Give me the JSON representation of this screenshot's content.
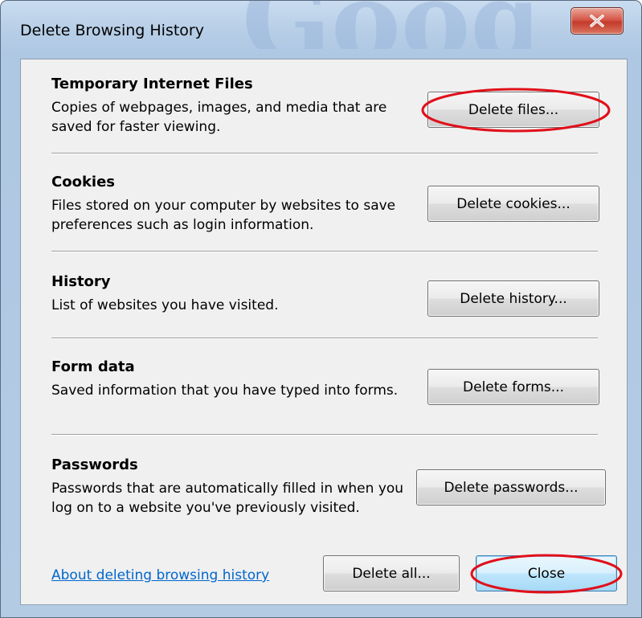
{
  "window": {
    "title": "Delete Browsing History",
    "background_logo_text": "Google"
  },
  "sections": [
    {
      "title": "Temporary Internet Files",
      "description": "Copies of webpages, images, and media that are saved for faster viewing.",
      "button": "Delete files...",
      "highlighted": true
    },
    {
      "title": "Cookies",
      "description": "Files stored on your computer by websites to save preferences such as login information.",
      "button": "Delete cookies..."
    },
    {
      "title": "History",
      "description": "List of websites you have visited.",
      "button": "Delete history..."
    },
    {
      "title": "Form data",
      "description": "Saved information that you have typed into forms.",
      "button": "Delete forms..."
    },
    {
      "title": "Passwords",
      "description": "Passwords that are automatically filled in when you log on to a website you've previously visited.",
      "button": "Delete passwords..."
    }
  ],
  "footer": {
    "link": "About deleting browsing history",
    "delete_all": "Delete all...",
    "close": "Close"
  },
  "colors": {
    "annotation": "#e0101a",
    "link": "#0066cc",
    "panel": "#f0f0f0"
  },
  "icons": {
    "title_close": "close-icon"
  }
}
